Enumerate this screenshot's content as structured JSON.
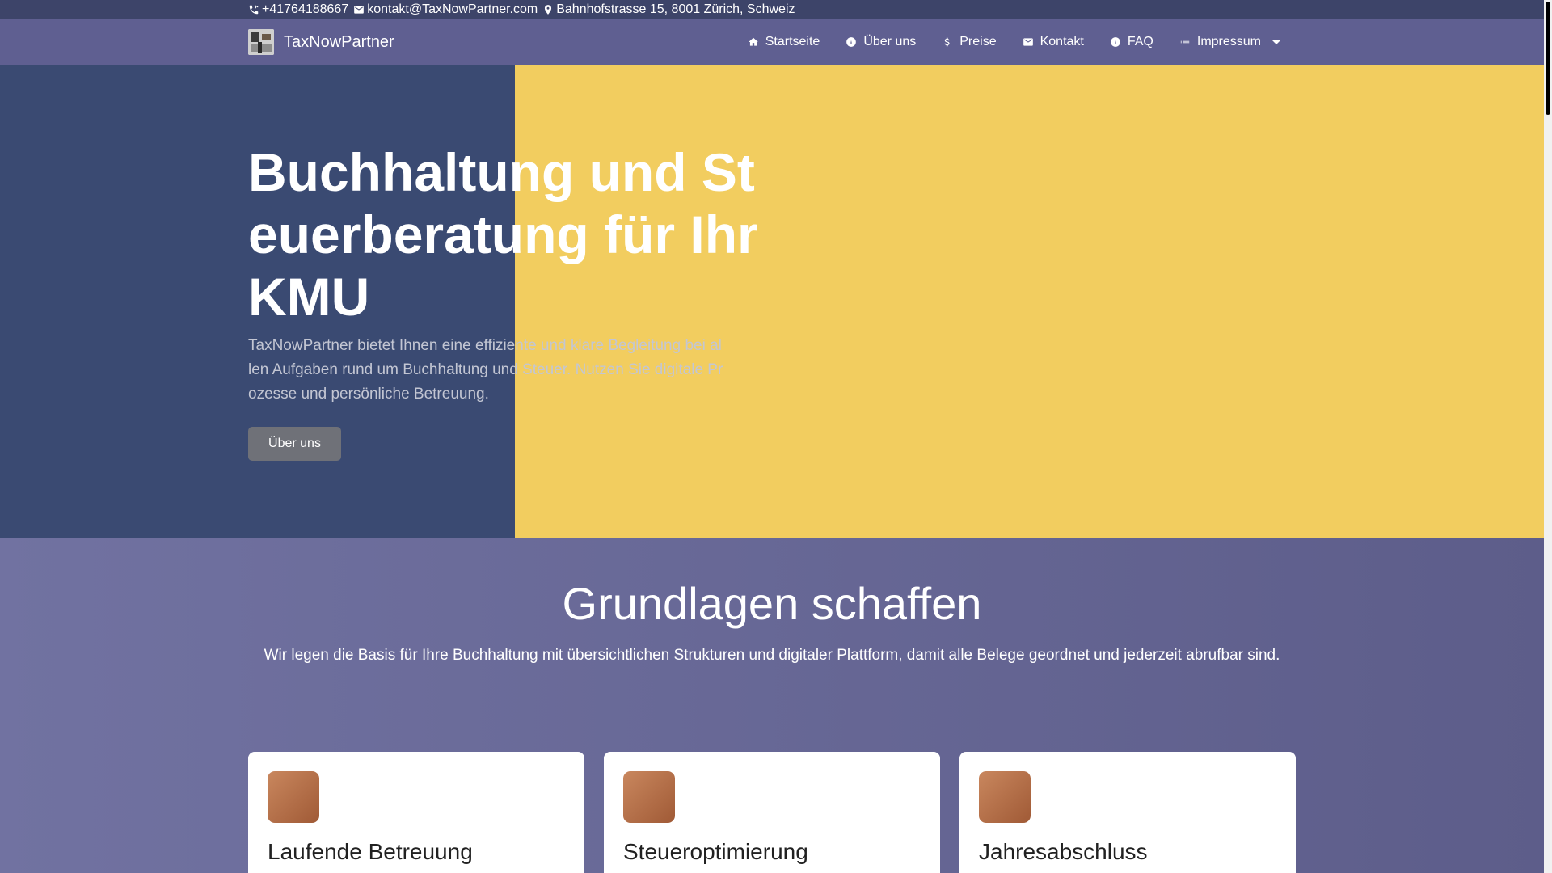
{
  "contact": {
    "phone": "+41764188667",
    "email": "kontakt@TaxNowPartner.com",
    "address": "Bahnhofstrasse 15, 8001 Zürich, Schweiz"
  },
  "brand": {
    "name": "TaxNowPartner"
  },
  "nav": {
    "items": [
      {
        "label": "Startseite",
        "icon": "home-icon"
      },
      {
        "label": "Über uns",
        "icon": "info-icon"
      },
      {
        "label": "Preise",
        "icon": "dollar-icon"
      },
      {
        "label": "Kontakt",
        "icon": "mail-icon"
      },
      {
        "label": "FAQ",
        "icon": "info-icon"
      },
      {
        "label": "Impressum",
        "icon": "list-icon"
      }
    ]
  },
  "hero": {
    "title": "Buchhaltung und Steuerberatung für Ihr KMU",
    "lead": "TaxNowPartner bietet Ihnen eine effiziente und klare Begleitung bei allen Aufgaben rund um Buchhaltung und Steuer. Nutzen Sie digitale Prozesse und persönliche Betreuung.",
    "button": "Über uns"
  },
  "section": {
    "title": "Grundlagen schaffen",
    "subtitle": "Wir legen die Basis für Ihre Buchhaltung mit übersichtlichen Strukturen und digitaler Plattform, damit alle Belege geordnet und jederzeit abrufbar sind.",
    "cards": [
      {
        "title": "Laufende Betreuung"
      },
      {
        "title": "Steueroptimierung"
      },
      {
        "title": "Jahresabschluss"
      }
    ]
  },
  "colors": {
    "topbar": "#3d4469",
    "navbar": "#5f5f91",
    "hero_left": "#3a4a72",
    "hero_right": "#f2cd5f",
    "card_icon": "#b0693f"
  }
}
